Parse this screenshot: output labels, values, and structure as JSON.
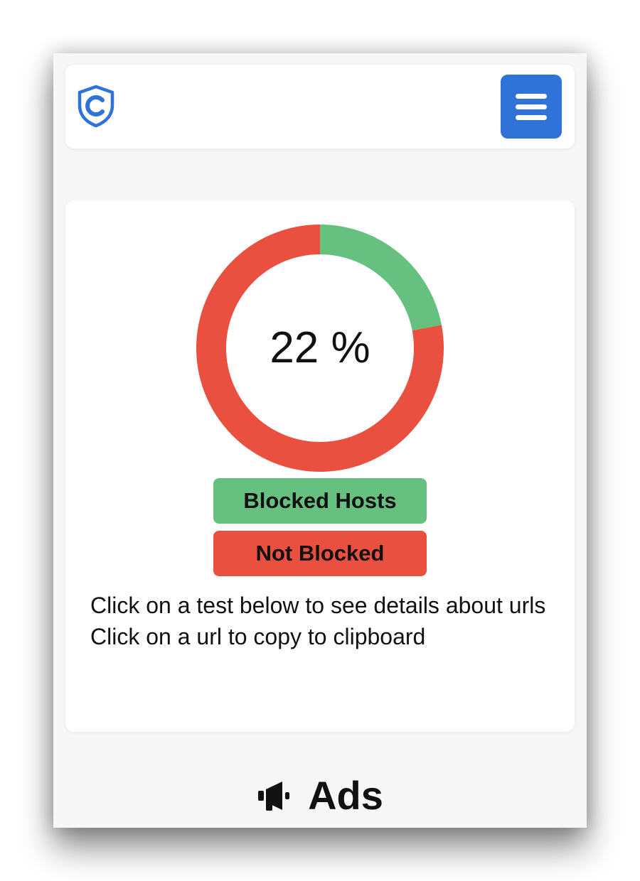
{
  "header": {
    "logo_icon": "shield-logo-icon",
    "menu_icon": "hamburger-menu-icon"
  },
  "results": {
    "percentage_label": "22 %",
    "legend": {
      "blocked_label": "Blocked Hosts",
      "not_blocked_label": "Not Blocked"
    },
    "instructions": {
      "line1": "Click on a test below to see details about urls",
      "line2": "Click on a url to copy to clipboard"
    }
  },
  "chart_data": {
    "type": "pie",
    "categories": [
      "Blocked Hosts",
      "Not Blocked"
    ],
    "values": [
      22,
      78
    ],
    "colors": [
      "#66c07f",
      "#e9503f"
    ]
  },
  "sections": [
    {
      "title": "Ads",
      "icon": "megaphone-icon"
    }
  ]
}
